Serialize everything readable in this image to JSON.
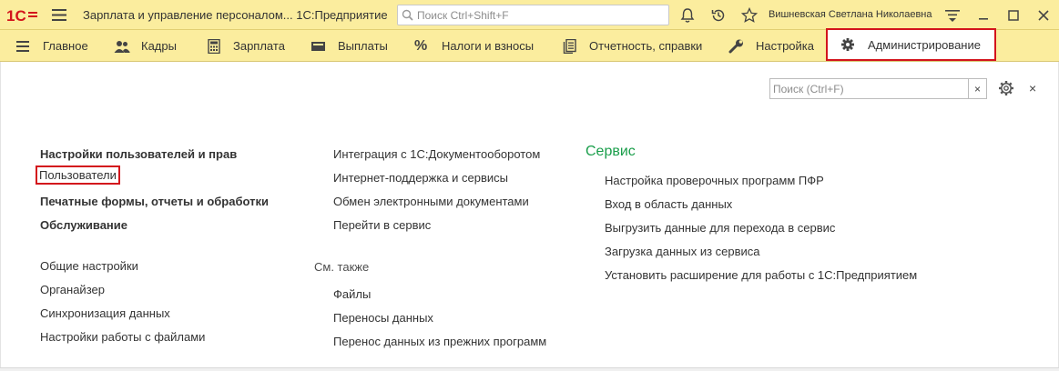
{
  "window": {
    "logo_text": "1С",
    "title": "Зарплата и управление персоналом... 1С:Предприятие",
    "search_placeholder": "Поиск Ctrl+Shift+F",
    "user_name": "Вишневская Светлана Николаевна"
  },
  "sections": [
    {
      "label": "Главное",
      "icon": "menu-icon"
    },
    {
      "label": "Кадры",
      "icon": "people-icon"
    },
    {
      "label": "Зарплата",
      "icon": "calculator-icon"
    },
    {
      "label": "Выплаты",
      "icon": "wallet-icon"
    },
    {
      "label": "Налоги и взносы",
      "icon": "percent-icon"
    },
    {
      "label": "Отчетность, справки",
      "icon": "reports-icon"
    },
    {
      "label": "Настройка",
      "icon": "wrench-icon"
    },
    {
      "label": "Администрирование",
      "icon": "gear-icon",
      "active": true
    }
  ],
  "content": {
    "search_placeholder": "Поиск (Ctrl+F)",
    "clear_label": "×",
    "close_label": "×",
    "col1": {
      "main": [
        "Настройки пользователей и прав",
        "Пользователи",
        "Печатные формы, отчеты и обработки",
        "Обслуживание"
      ],
      "other": [
        "Общие настройки",
        "Органайзер",
        "Синхронизация данных",
        "Настройки работы с файлами"
      ]
    },
    "col2": {
      "main": [
        "Интеграция с 1С:Документооборотом",
        "Интернет-поддержка и сервисы",
        "Обмен электронными документами",
        "Перейти в сервис"
      ],
      "see_also_header": "См. также",
      "see_also": [
        "Файлы",
        "Переносы данных",
        "Перенос данных из прежних программ"
      ]
    },
    "col3": {
      "header": "Сервис",
      "items": [
        "Настройка проверочных программ ПФР",
        "Вход в область данных",
        "Выгрузить данные для перехода в сервис",
        "Загрузка данных из сервиса",
        "Установить расширение для работы с 1С:Предприятием"
      ]
    }
  },
  "colors": {
    "accent_bar": "#fbed9e",
    "highlight": "#d3141c",
    "service_header": "#1a9e4b"
  }
}
